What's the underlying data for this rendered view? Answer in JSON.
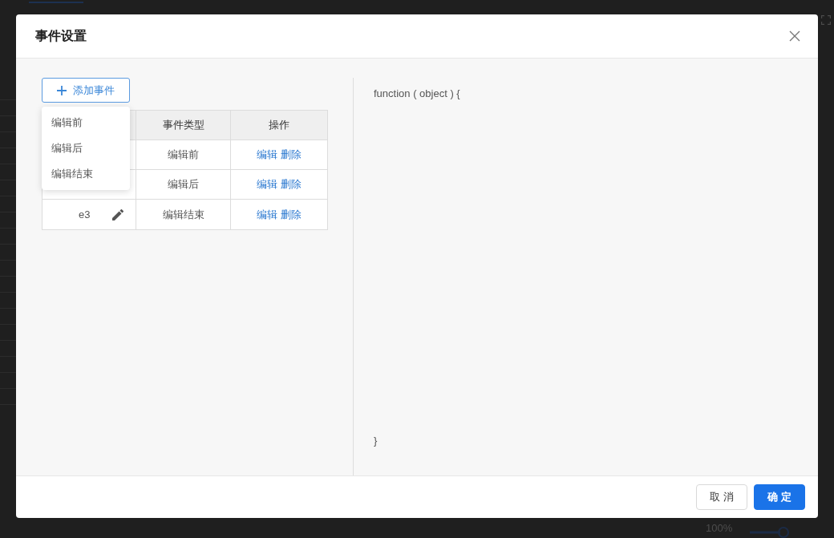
{
  "background": {
    "zoom_reading": "100%"
  },
  "dialog": {
    "title": "事件设置"
  },
  "add_button": {
    "label": "添加事件"
  },
  "dropdown": {
    "items": [
      "编辑前",
      "编辑后",
      "编辑结束"
    ]
  },
  "table": {
    "columns": [
      "事件类型",
      "操作"
    ],
    "rows": [
      {
        "event_type": "编辑前",
        "actions": [
          "编辑",
          "删除"
        ]
      },
      {
        "event_type": "编辑后",
        "actions": [
          "编辑",
          "删除"
        ]
      },
      {
        "column_1": "e3",
        "event_type": "编辑结束",
        "actions": [
          "编辑",
          "删除"
        ]
      }
    ]
  },
  "code": {
    "opening": "function ( object ) {",
    "closing": "}"
  },
  "footer": {
    "buttons": [
      {
        "label": "取 消",
        "kind": "secondary"
      },
      {
        "label": "确 定",
        "kind": "primary"
      }
    ]
  }
}
